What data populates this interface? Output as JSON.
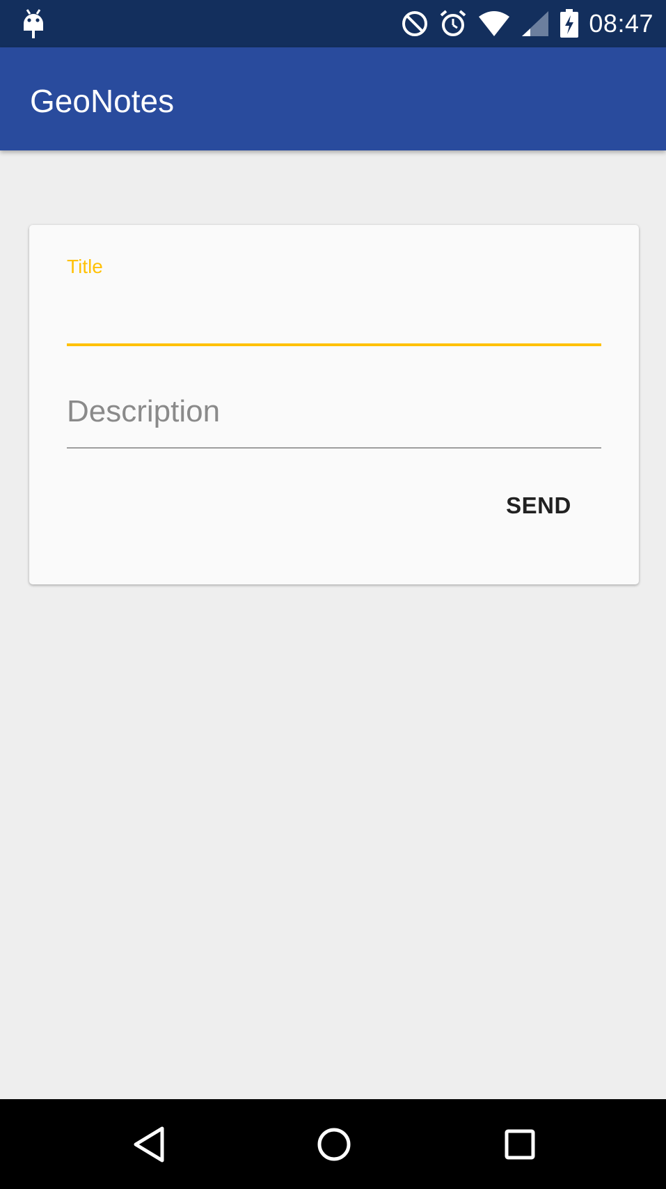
{
  "status_bar": {
    "time": "08:47",
    "icons": [
      "android-debug-icon",
      "do-not-disturb-icon",
      "alarm-icon",
      "wifi-icon",
      "cellular-signal-icon",
      "battery-charging-icon"
    ]
  },
  "app_bar": {
    "title": "GeoNotes"
  },
  "form": {
    "title_label": "Title",
    "title_value": "",
    "description_placeholder": "Description",
    "description_value": "",
    "send_label": "SEND"
  },
  "nav_bar": {
    "icons": [
      "back-icon",
      "home-icon",
      "recents-icon"
    ]
  },
  "colors": {
    "status_bar": "#132f5d",
    "app_bar": "#294b9d",
    "accent": "#ffc107",
    "background": "#eeeeee",
    "card": "#fafafa"
  }
}
